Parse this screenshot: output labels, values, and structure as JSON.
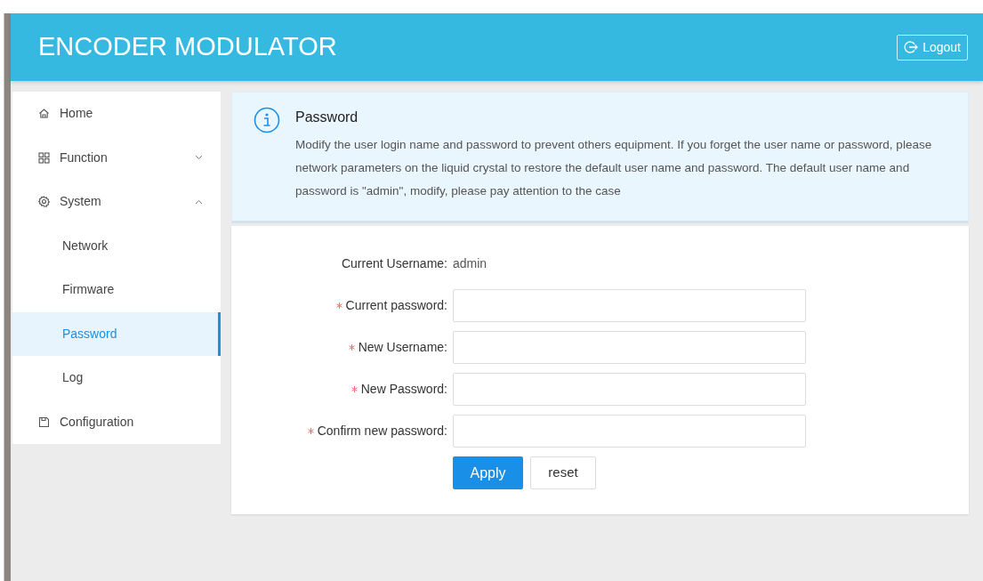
{
  "header": {
    "title": "ENCODER MODULATOR",
    "logout": "Logout"
  },
  "sidebar": {
    "items": [
      {
        "label": "Home",
        "kind": "link",
        "selected": false
      },
      {
        "label": "Function",
        "kind": "group",
        "expanded": false,
        "selected": false
      },
      {
        "label": "System",
        "kind": "group",
        "expanded": true,
        "selected": false,
        "children": [
          {
            "label": "Network",
            "selected": false
          },
          {
            "label": "Firmware",
            "selected": false
          },
          {
            "label": "Password",
            "selected": true
          },
          {
            "label": "Log",
            "selected": false
          }
        ]
      },
      {
        "label": "Configuration",
        "kind": "link",
        "selected": false
      }
    ]
  },
  "notice": {
    "title": "Password",
    "text": "Modify the user login name and password to prevent others equipment. If you forget the user name or password, please network parameters on the liquid crystal to restore the default user name and password. The default user name and password is \"admin\", modify, please pay attention to the case"
  },
  "form": {
    "fields": [
      {
        "label": "Current Username:",
        "kind": "text",
        "value": "admin",
        "required": false
      },
      {
        "label": "Current password:",
        "kind": "input",
        "required": true
      },
      {
        "label": "New Username:",
        "kind": "input",
        "required": true
      },
      {
        "label": "New Password:",
        "kind": "input",
        "required": true
      },
      {
        "label": "Confirm new password:",
        "kind": "input",
        "required": true
      }
    ],
    "buttons": [
      {
        "label": "Apply",
        "kind": "primary"
      },
      {
        "label": "reset",
        "kind": "default"
      }
    ]
  }
}
